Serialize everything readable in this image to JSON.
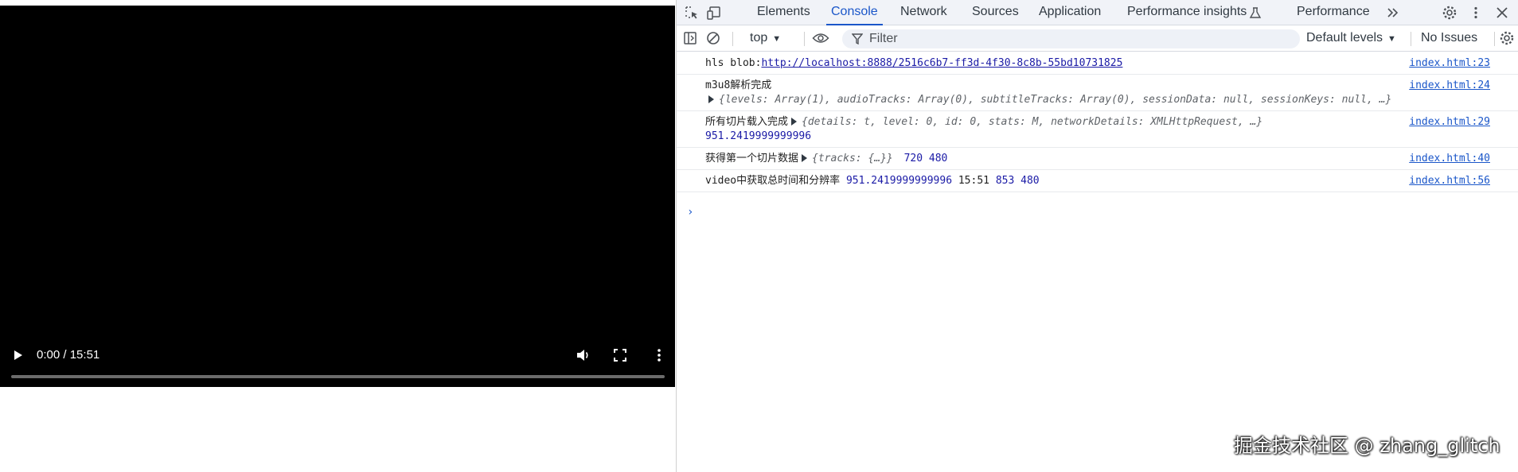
{
  "video": {
    "current_time": "0:00",
    "separator": " / ",
    "duration": "15:51",
    "progress": 0
  },
  "devtools": {
    "tabs": [
      {
        "label": "Elements",
        "active": false
      },
      {
        "label": "Console",
        "active": true
      },
      {
        "label": "Network",
        "active": false
      },
      {
        "label": "Sources",
        "active": false
      },
      {
        "label": "Application",
        "active": false
      },
      {
        "label": "Performance insights",
        "active": false
      },
      {
        "label": "Performance",
        "active": false
      }
    ],
    "toolbar": {
      "context": "top",
      "filter_placeholder": "Filter",
      "levels": "Default levels",
      "issues": "No Issues"
    },
    "messages": [
      {
        "text": "hls blob:",
        "url": "http://localhost:8888/2516c6b7-ff3d-4f30-8c8b-55bd10731825",
        "source": "index.html:23"
      },
      {
        "text": "m3u8解析完成",
        "source": "index.html:24",
        "object": "{levels: Array(1), audioTracks: Array(0), subtitleTracks: Array(0), sessionData: null, sessionKeys: null,  …}"
      },
      {
        "text": "所有切片载入完成",
        "source": "index.html:29",
        "object": "{details: t, level: 0, id: 0, stats: M, networkDetails: XMLHttpRequest,  …}",
        "number": "951.2419999999996"
      },
      {
        "text": "获得第一个切片数据",
        "source": "index.html:40",
        "object": "{tracks: {…}}",
        "values": "720 480"
      },
      {
        "text": "video中获取总时间和分辨率",
        "source": "index.html:56",
        "n1": "951.2419999999996",
        "n2": "15:51",
        "n3": "853 480"
      }
    ]
  },
  "watermark": "掘金技术社区 @ zhang_glitch"
}
